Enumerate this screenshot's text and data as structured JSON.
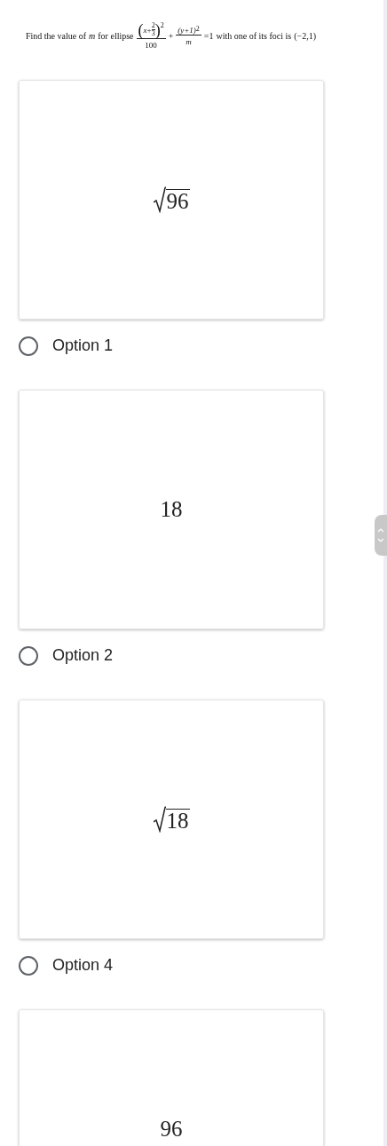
{
  "question": {
    "prefix": "Find the value of",
    "variable": "m",
    "middle": "for ellipse",
    "frac1": {
      "open": "(",
      "var": "x",
      "op": "+",
      "inner_num": "2",
      "inner_den": "3",
      "close": ")",
      "exp": "2",
      "den": "100"
    },
    "plus": "+",
    "frac2": {
      "num": "(y+1)",
      "exp": "2",
      "den": "m"
    },
    "equals": "=1",
    "suffix": "with one of its foci is",
    "point": "(−2,1)"
  },
  "choices": [
    {
      "kind": "sqrt",
      "value": "96",
      "label": "Option 1",
      "selected": false
    },
    {
      "kind": "plain",
      "value": "18",
      "label": "Option 2",
      "selected": false
    },
    {
      "kind": "sqrt",
      "value": "18",
      "label": "Option 4",
      "selected": false
    },
    {
      "kind": "plain",
      "value": "96"
    }
  ]
}
